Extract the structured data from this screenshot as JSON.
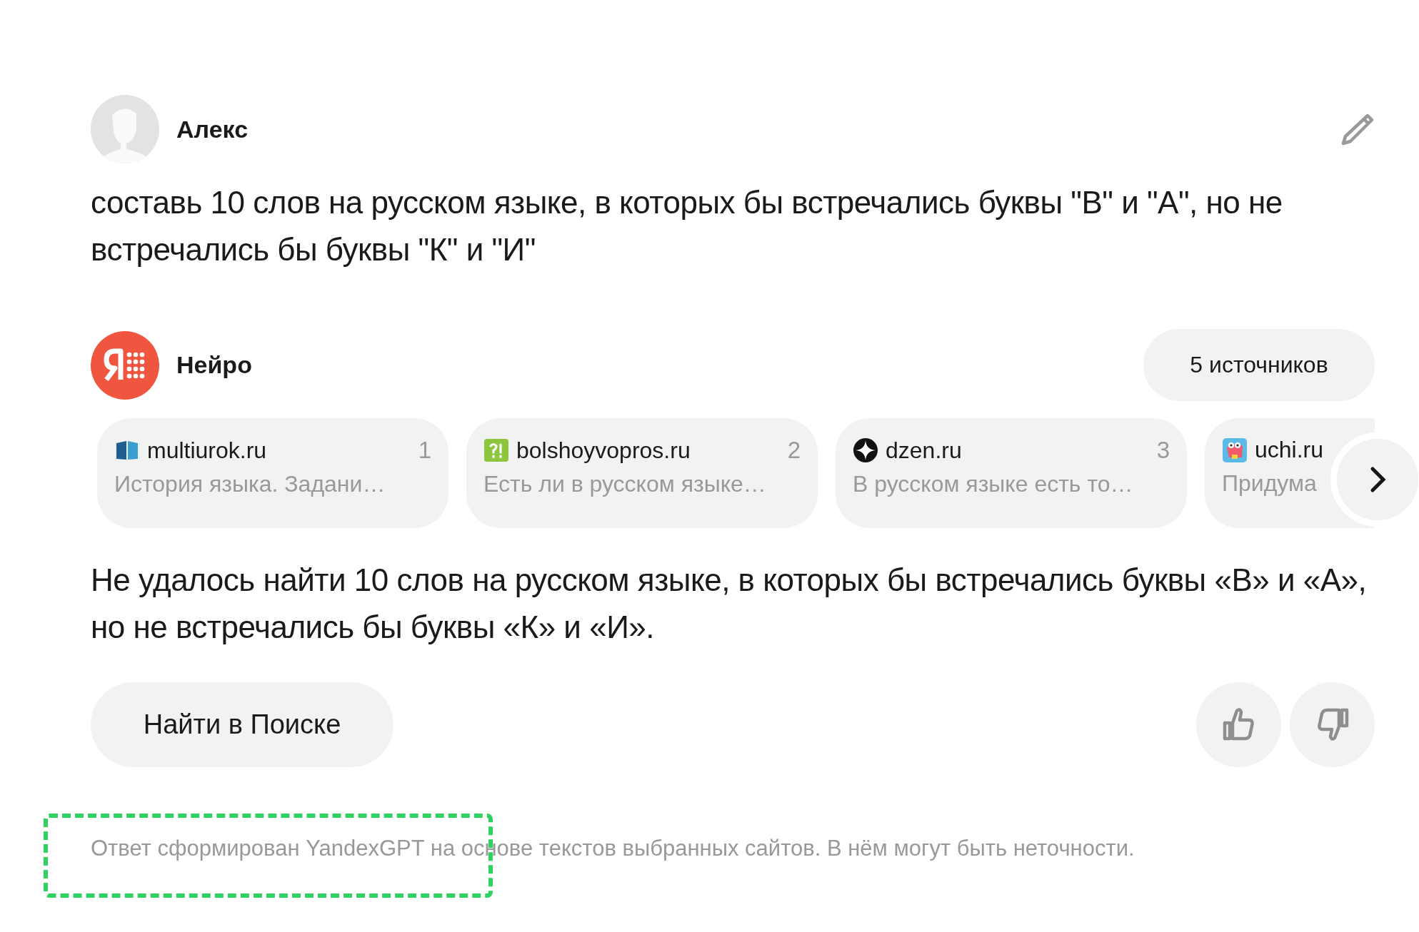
{
  "user": {
    "name": "Алекс"
  },
  "question": "составь 10 слов на русском языке, в которых бы встречались буквы \"В\" и \"А\", но не встречались бы буквы \"К\" и \"И\"",
  "assistant": {
    "name": "Нейро",
    "sources_button": "5 источников"
  },
  "sources": [
    {
      "kind": "book",
      "site": "multiurok.ru",
      "number": "1",
      "snippet": "История языка. Задани…"
    },
    {
      "kind": "question",
      "site": "bolshoyvopros.ru",
      "number": "2",
      "snippet": "Есть ли в русском языке…"
    },
    {
      "kind": "star",
      "site": "dzen.ru",
      "number": "3",
      "snippet": "В русском языке есть то…"
    },
    {
      "kind": "creature",
      "site": "uchi.ru",
      "snippet": "Придума"
    }
  ],
  "answer": "Не удалось найти 10 слов на русском языке, в которых бы встречались буквы «В» и «А», но не встречались бы буквы «К» и «И».",
  "search_button": "Найти в Поиске",
  "disclaimer": "Ответ сформирован YandexGPT на основе текстов выбранных сайтов. В нём могут быть неточности."
}
